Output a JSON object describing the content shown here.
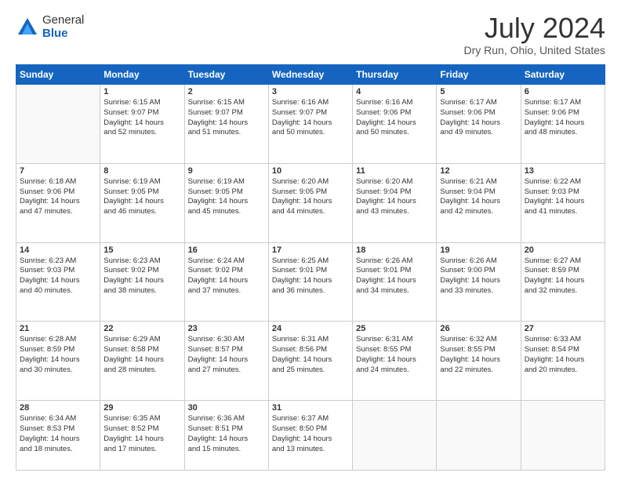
{
  "logo": {
    "general": "General",
    "blue": "Blue"
  },
  "title": {
    "month_year": "July 2024",
    "location": "Dry Run, Ohio, United States"
  },
  "headers": [
    "Sunday",
    "Monday",
    "Tuesday",
    "Wednesday",
    "Thursday",
    "Friday",
    "Saturday"
  ],
  "weeks": [
    [
      {
        "day": "",
        "lines": []
      },
      {
        "day": "1",
        "lines": [
          "Sunrise: 6:15 AM",
          "Sunset: 9:07 PM",
          "Daylight: 14 hours",
          "and 52 minutes."
        ]
      },
      {
        "day": "2",
        "lines": [
          "Sunrise: 6:15 AM",
          "Sunset: 9:07 PM",
          "Daylight: 14 hours",
          "and 51 minutes."
        ]
      },
      {
        "day": "3",
        "lines": [
          "Sunrise: 6:16 AM",
          "Sunset: 9:07 PM",
          "Daylight: 14 hours",
          "and 50 minutes."
        ]
      },
      {
        "day": "4",
        "lines": [
          "Sunrise: 6:16 AM",
          "Sunset: 9:06 PM",
          "Daylight: 14 hours",
          "and 50 minutes."
        ]
      },
      {
        "day": "5",
        "lines": [
          "Sunrise: 6:17 AM",
          "Sunset: 9:06 PM",
          "Daylight: 14 hours",
          "and 49 minutes."
        ]
      },
      {
        "day": "6",
        "lines": [
          "Sunrise: 6:17 AM",
          "Sunset: 9:06 PM",
          "Daylight: 14 hours",
          "and 48 minutes."
        ]
      }
    ],
    [
      {
        "day": "7",
        "lines": [
          "Sunrise: 6:18 AM",
          "Sunset: 9:06 PM",
          "Daylight: 14 hours",
          "and 47 minutes."
        ]
      },
      {
        "day": "8",
        "lines": [
          "Sunrise: 6:19 AM",
          "Sunset: 9:05 PM",
          "Daylight: 14 hours",
          "and 46 minutes."
        ]
      },
      {
        "day": "9",
        "lines": [
          "Sunrise: 6:19 AM",
          "Sunset: 9:05 PM",
          "Daylight: 14 hours",
          "and 45 minutes."
        ]
      },
      {
        "day": "10",
        "lines": [
          "Sunrise: 6:20 AM",
          "Sunset: 9:05 PM",
          "Daylight: 14 hours",
          "and 44 minutes."
        ]
      },
      {
        "day": "11",
        "lines": [
          "Sunrise: 6:20 AM",
          "Sunset: 9:04 PM",
          "Daylight: 14 hours",
          "and 43 minutes."
        ]
      },
      {
        "day": "12",
        "lines": [
          "Sunrise: 6:21 AM",
          "Sunset: 9:04 PM",
          "Daylight: 14 hours",
          "and 42 minutes."
        ]
      },
      {
        "day": "13",
        "lines": [
          "Sunrise: 6:22 AM",
          "Sunset: 9:03 PM",
          "Daylight: 14 hours",
          "and 41 minutes."
        ]
      }
    ],
    [
      {
        "day": "14",
        "lines": [
          "Sunrise: 6:23 AM",
          "Sunset: 9:03 PM",
          "Daylight: 14 hours",
          "and 40 minutes."
        ]
      },
      {
        "day": "15",
        "lines": [
          "Sunrise: 6:23 AM",
          "Sunset: 9:02 PM",
          "Daylight: 14 hours",
          "and 38 minutes."
        ]
      },
      {
        "day": "16",
        "lines": [
          "Sunrise: 6:24 AM",
          "Sunset: 9:02 PM",
          "Daylight: 14 hours",
          "and 37 minutes."
        ]
      },
      {
        "day": "17",
        "lines": [
          "Sunrise: 6:25 AM",
          "Sunset: 9:01 PM",
          "Daylight: 14 hours",
          "and 36 minutes."
        ]
      },
      {
        "day": "18",
        "lines": [
          "Sunrise: 6:26 AM",
          "Sunset: 9:01 PM",
          "Daylight: 14 hours",
          "and 34 minutes."
        ]
      },
      {
        "day": "19",
        "lines": [
          "Sunrise: 6:26 AM",
          "Sunset: 9:00 PM",
          "Daylight: 14 hours",
          "and 33 minutes."
        ]
      },
      {
        "day": "20",
        "lines": [
          "Sunrise: 6:27 AM",
          "Sunset: 8:59 PM",
          "Daylight: 14 hours",
          "and 32 minutes."
        ]
      }
    ],
    [
      {
        "day": "21",
        "lines": [
          "Sunrise: 6:28 AM",
          "Sunset: 8:59 PM",
          "Daylight: 14 hours",
          "and 30 minutes."
        ]
      },
      {
        "day": "22",
        "lines": [
          "Sunrise: 6:29 AM",
          "Sunset: 8:58 PM",
          "Daylight: 14 hours",
          "and 28 minutes."
        ]
      },
      {
        "day": "23",
        "lines": [
          "Sunrise: 6:30 AM",
          "Sunset: 8:57 PM",
          "Daylight: 14 hours",
          "and 27 minutes."
        ]
      },
      {
        "day": "24",
        "lines": [
          "Sunrise: 6:31 AM",
          "Sunset: 8:56 PM",
          "Daylight: 14 hours",
          "and 25 minutes."
        ]
      },
      {
        "day": "25",
        "lines": [
          "Sunrise: 6:31 AM",
          "Sunset: 8:55 PM",
          "Daylight: 14 hours",
          "and 24 minutes."
        ]
      },
      {
        "day": "26",
        "lines": [
          "Sunrise: 6:32 AM",
          "Sunset: 8:55 PM",
          "Daylight: 14 hours",
          "and 22 minutes."
        ]
      },
      {
        "day": "27",
        "lines": [
          "Sunrise: 6:33 AM",
          "Sunset: 8:54 PM",
          "Daylight: 14 hours",
          "and 20 minutes."
        ]
      }
    ],
    [
      {
        "day": "28",
        "lines": [
          "Sunrise: 6:34 AM",
          "Sunset: 8:53 PM",
          "Daylight: 14 hours",
          "and 18 minutes."
        ]
      },
      {
        "day": "29",
        "lines": [
          "Sunrise: 6:35 AM",
          "Sunset: 8:52 PM",
          "Daylight: 14 hours",
          "and 17 minutes."
        ]
      },
      {
        "day": "30",
        "lines": [
          "Sunrise: 6:36 AM",
          "Sunset: 8:51 PM",
          "Daylight: 14 hours",
          "and 15 minutes."
        ]
      },
      {
        "day": "31",
        "lines": [
          "Sunrise: 6:37 AM",
          "Sunset: 8:50 PM",
          "Daylight: 14 hours",
          "and 13 minutes."
        ]
      },
      {
        "day": "",
        "lines": []
      },
      {
        "day": "",
        "lines": []
      },
      {
        "day": "",
        "lines": []
      }
    ]
  ]
}
